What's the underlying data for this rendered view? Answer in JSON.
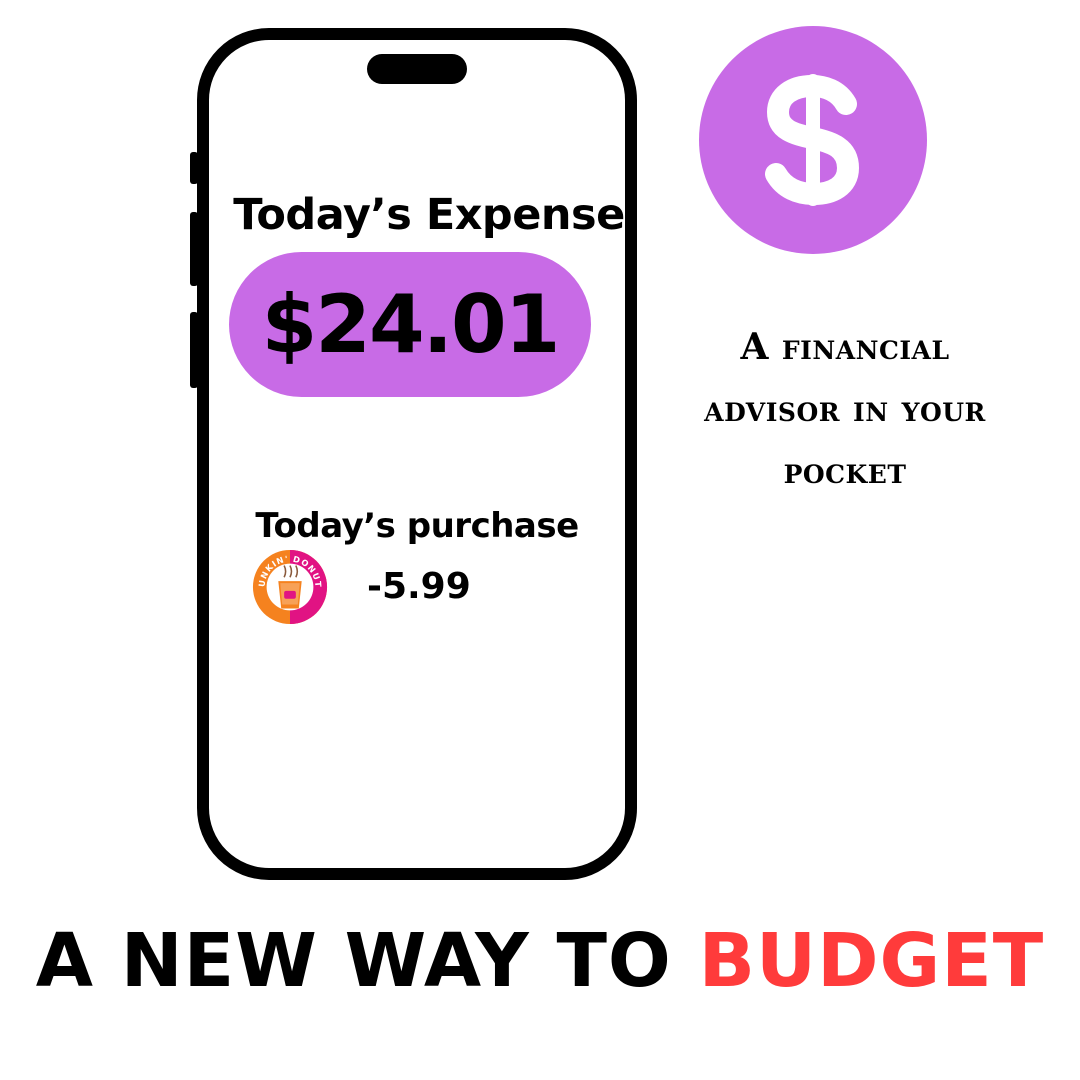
{
  "phone_screen": {
    "expense_title": "Today’s Expense",
    "expense_amount": "$24.01",
    "purchase_title": "Today’s purchase",
    "purchases": [
      {
        "merchant_icon": "dunkin-donuts-logo-icon",
        "merchant_logo_text": "DUNKIN' DONUTS",
        "amount": "-5.99"
      }
    ]
  },
  "dollar_badge": {
    "icon": "dollar-sign-icon"
  },
  "tagline": "A financial advisor in your pocket",
  "headline": {
    "lead": "A NEW WAY TO",
    "accent": "BUDGET"
  },
  "colors": {
    "accent_purple": "#c86be6",
    "headline_accent": "#ff3b3b",
    "text": "#000000",
    "background": "#ffffff"
  }
}
